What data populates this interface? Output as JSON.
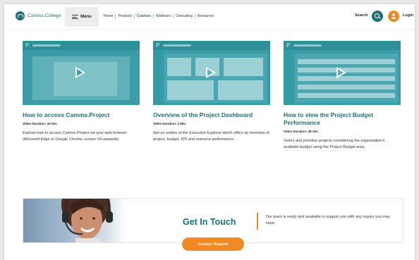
{
  "header": {
    "logo_text": "Camms.College",
    "menu_label": "Menu",
    "nav": [
      "Home",
      "Products",
      "Courses",
      "Webinars",
      "Consulting",
      "Resources"
    ],
    "active_nav": "Courses",
    "search_label": "Search",
    "login_label": "Login"
  },
  "videos": [
    {
      "title": "How to access Camms.Project",
      "duration": "Video Duration: 43 Sec",
      "description": "Explore how to access Camms.Project via your web browser (Microsoft Edge or Google Chrome version 54 upwards)."
    },
    {
      "title": "Overview of the Project Dashboard",
      "duration": "Video Duration: 2 Min",
      "description": "Get an outline of the Executive Explorer which offers an overview of project, budget, KPI and resource performance."
    },
    {
      "title": "How to view the Project Budget Performance",
      "duration": "Video Duration: 39 Sec",
      "description": "Select and prioritise projects considering the organisation's available budget using the Project Budget area."
    }
  ],
  "contact": {
    "title": "Get In Touch",
    "text": "Our team is ready and available to support you with any inquiry you may have.",
    "button_label": "Contact Support"
  },
  "colors": {
    "brand_teal": "#1f6e78",
    "accent_orange": "#f08a24",
    "thumbnail_teal": "#3a9ca6"
  }
}
